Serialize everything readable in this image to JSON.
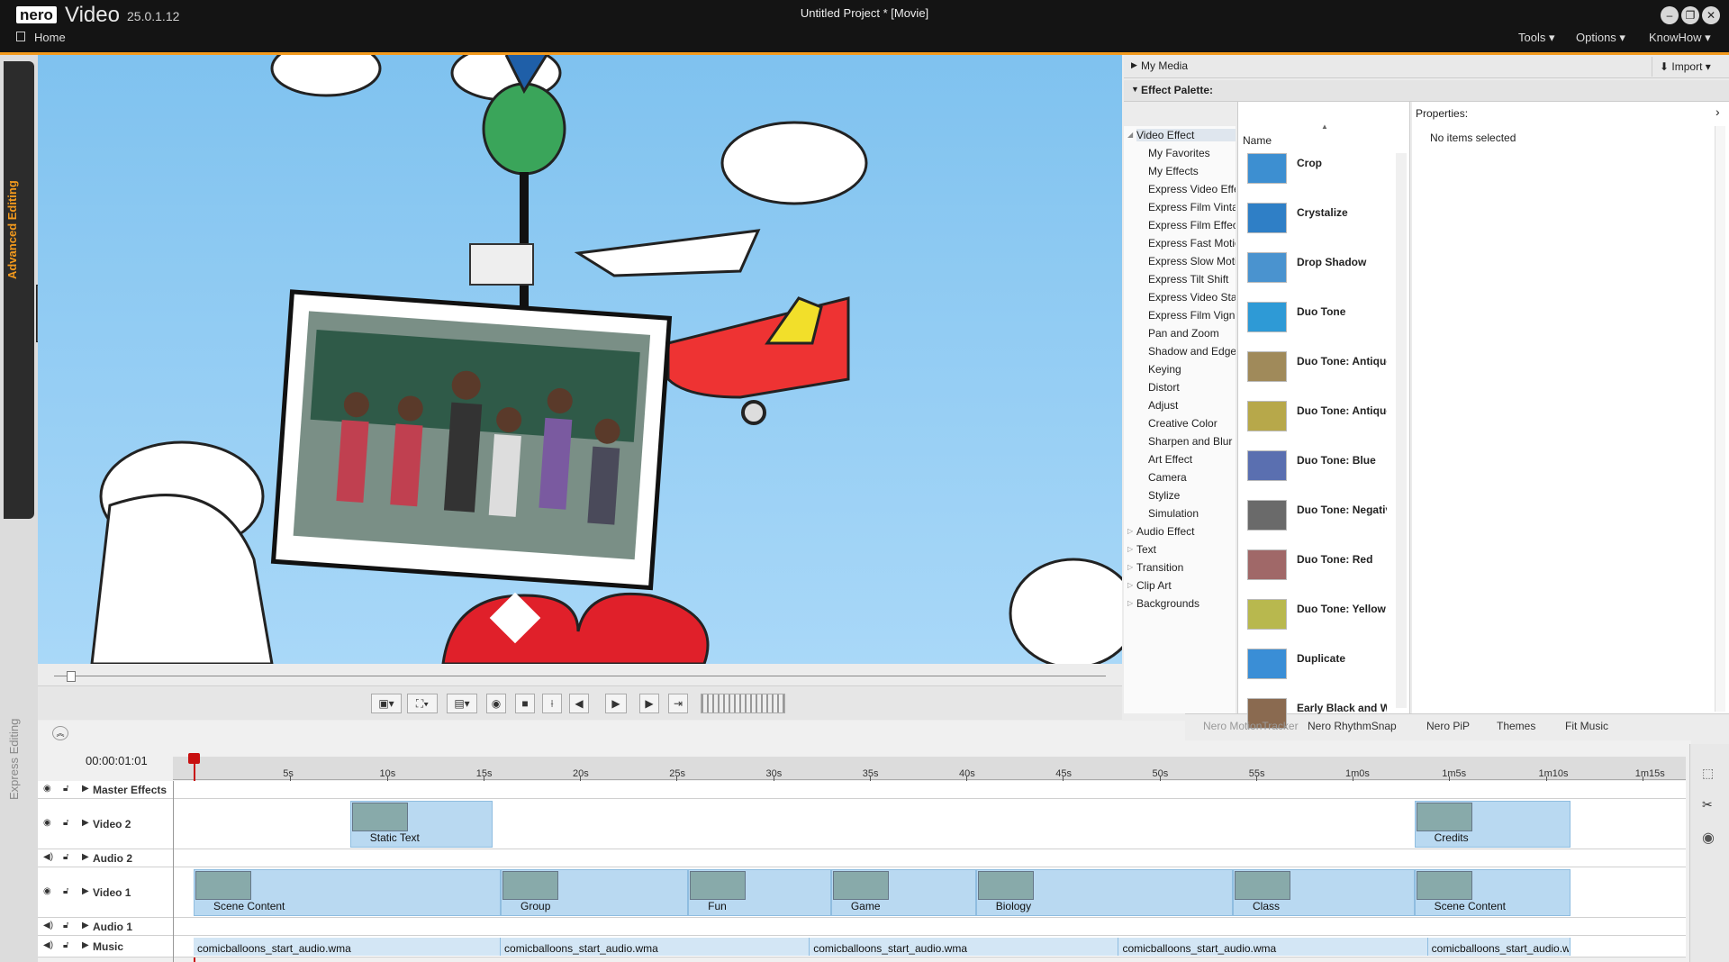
{
  "titlebar": {
    "brand": "nero",
    "app": "Video",
    "version": "25.0.1.12",
    "project": "Untitled Project * [Movie]",
    "home": "Home",
    "menus": [
      "Tools",
      "Options",
      "KnowHow"
    ]
  },
  "side_tabs": {
    "advanced": "Advanced Editing",
    "express": "Express Editing"
  },
  "panels": {
    "my_media": "My Media",
    "import": "Import",
    "effect_palette": "Effect Palette:",
    "properties": "Properties:",
    "no_selection": "No items selected",
    "name_header": "Name"
  },
  "categories": [
    {
      "label": "Video Effect",
      "level": 0
    },
    {
      "label": "My Favorites",
      "level": 1
    },
    {
      "label": "My Effects",
      "level": 1
    },
    {
      "label": "Express Video Effects",
      "level": 1
    },
    {
      "label": "Express Film Vintage",
      "level": 1
    },
    {
      "label": "Express Film Effects",
      "level": 1
    },
    {
      "label": "Express Fast Motion",
      "level": 1
    },
    {
      "label": "Express Slow Motion",
      "level": 1
    },
    {
      "label": "Express Tilt Shift",
      "level": 1
    },
    {
      "label": "Express Video Stabilization",
      "level": 1
    },
    {
      "label": "Express Film Vignette",
      "level": 1
    },
    {
      "label": "Pan and Zoom",
      "level": 1
    },
    {
      "label": "Shadow and Edges",
      "level": 1
    },
    {
      "label": "Keying",
      "level": 1
    },
    {
      "label": "Distort",
      "level": 1
    },
    {
      "label": "Adjust",
      "level": 1
    },
    {
      "label": "Creative Color",
      "level": 1
    },
    {
      "label": "Sharpen and Blur",
      "level": 1
    },
    {
      "label": "Art Effect",
      "level": 1
    },
    {
      "label": "Camera",
      "level": 1
    },
    {
      "label": "Stylize",
      "level": 1
    },
    {
      "label": "Simulation",
      "level": 1
    },
    {
      "label": "Audio Effect",
      "level": 0
    },
    {
      "label": "Text",
      "level": 0
    },
    {
      "label": "Transition",
      "level": 0
    },
    {
      "label": "Clip Art",
      "level": 0
    },
    {
      "label": "Backgrounds",
      "level": 0
    }
  ],
  "effects": [
    {
      "label": "Crop",
      "color": "#3d8fd1"
    },
    {
      "label": "Crystalize",
      "color": "#2f7fc6"
    },
    {
      "label": "Drop Shadow",
      "color": "#4a93cf"
    },
    {
      "label": "Duo Tone",
      "color": "#2e9ad6"
    },
    {
      "label": "Duo Tone: Antique",
      "color": "#a08a5a"
    },
    {
      "label": "Duo Tone: Antique",
      "color": "#b7a84a"
    },
    {
      "label": "Duo Tone: Blue",
      "color": "#5a6fb0"
    },
    {
      "label": "Duo Tone: Negative",
      "color": "#6a6a6a"
    },
    {
      "label": "Duo Tone: Red",
      "color": "#a06868"
    },
    {
      "label": "Duo Tone: Yellow",
      "color": "#b8b84e"
    },
    {
      "label": "Duplicate",
      "color": "#3a8ed6"
    },
    {
      "label": "Early Black and White",
      "color": "#8a6a50"
    }
  ],
  "timeline_tools": [
    "Nero MotionTracker",
    "Nero RhythmSnap",
    "Nero PiP",
    "Themes",
    "Fit Music"
  ],
  "timecode": "00:00:01:01",
  "ruler_ticks": [
    "5s",
    "10s",
    "15s",
    "20s",
    "25s",
    "30s",
    "35s",
    "40s",
    "45s",
    "50s",
    "55s",
    "1m0s",
    "1m5s",
    "1m10s",
    "1m15s"
  ],
  "tracks": {
    "master": "Master Effects",
    "video2": "Video 2",
    "audio2": "Audio 2",
    "video1": "Video 1",
    "audio1": "Audio 1",
    "music": "Music"
  },
  "video2_clips": [
    {
      "label": "Static Text",
      "start": 8.1,
      "end": 15.5
    },
    {
      "label": "Credits",
      "start": 63.2,
      "end": 71.3
    }
  ],
  "video1_clips": [
    {
      "label": "Scene Content",
      "start": 0.0,
      "end": 15.9
    },
    {
      "label": "Group",
      "start": 15.9,
      "end": 25.6
    },
    {
      "label": "Fun",
      "start": 25.6,
      "end": 33.0
    },
    {
      "label": "Game",
      "start": 33.0,
      "end": 40.5
    },
    {
      "label": "Biology",
      "start": 40.5,
      "end": 53.8
    },
    {
      "label": "Class",
      "start": 53.8,
      "end": 63.2
    },
    {
      "label": "Scene Content",
      "start": 63.2,
      "end": 71.3
    }
  ],
  "music_clips": [
    {
      "label": "comicballoons_start_audio.wma",
      "start": 0.0,
      "end": 15.9
    },
    {
      "label": "comicballoons_start_audio.wma",
      "start": 15.9,
      "end": 31.9
    },
    {
      "label": "comicballoons_start_audio.wma",
      "start": 31.9,
      "end": 47.9
    },
    {
      "label": "comicballoons_start_audio.wma",
      "start": 47.9,
      "end": 63.9
    },
    {
      "label": "comicballoons_start_audio.wma",
      "start": 63.9,
      "end": 71.3
    }
  ]
}
